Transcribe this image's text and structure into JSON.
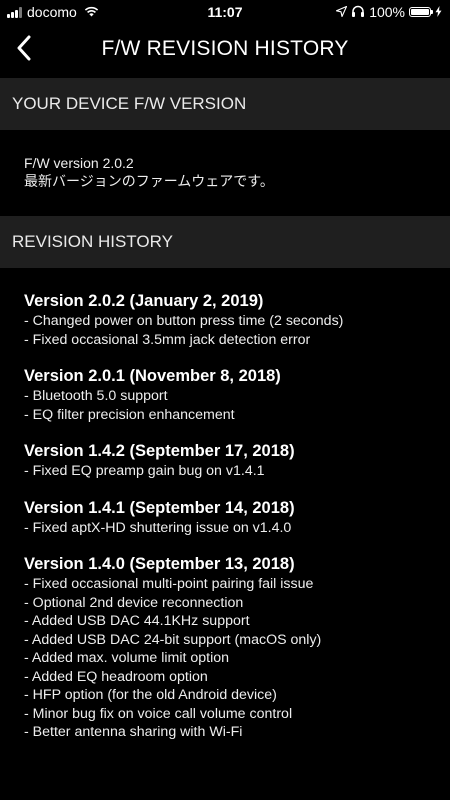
{
  "status_bar": {
    "carrier": "docomo",
    "time": "11:07",
    "battery": "100%",
    "battery_level": 1.0,
    "icons": [
      "signal-icon",
      "wifi-icon",
      "location-icon",
      "headphones-icon",
      "battery-icon",
      "charging-icon"
    ]
  },
  "nav": {
    "title": "F/W REVISION HISTORY",
    "back_icon": "chevron-left-icon"
  },
  "device_section": {
    "header": "YOUR DEVICE F/W VERSION",
    "version_text": "F/W version 2.0.2",
    "status_text": "最新バージョンのファームウェアです。"
  },
  "history_section": {
    "header": "REVISION HISTORY",
    "entries": [
      {
        "title": "Version 2.0.2 (January 2, 2019)",
        "changes": [
          "- Changed power on button press time (2 seconds)",
          "- Fixed occasional 3.5mm jack detection error"
        ]
      },
      {
        "title": "Version 2.0.1 (November 8, 2018)",
        "changes": [
          "- Bluetooth 5.0 support",
          "- EQ filter precision enhancement"
        ]
      },
      {
        "title": "Version 1.4.2 (September 17, 2018)",
        "changes": [
          "- Fixed EQ preamp gain bug on v1.4.1"
        ]
      },
      {
        "title": "Version 1.4.1 (September 14, 2018)",
        "changes": [
          "- Fixed aptX-HD shuttering issue on v1.4.0"
        ]
      },
      {
        "title": "Version 1.4.0 (September 13, 2018)",
        "changes": [
          "- Fixed occasional multi-point pairing fail issue",
          "- Optional 2nd device reconnection",
          "- Added USB DAC 44.1KHz support",
          "- Added USB DAC 24-bit support (macOS only)",
          "- Added max. volume limit option",
          "- Added EQ headroom option",
          "- HFP option (for the old Android device)",
          "- Minor bug fix on voice call volume control",
          "- Better antenna sharing with Wi-Fi"
        ]
      }
    ]
  }
}
